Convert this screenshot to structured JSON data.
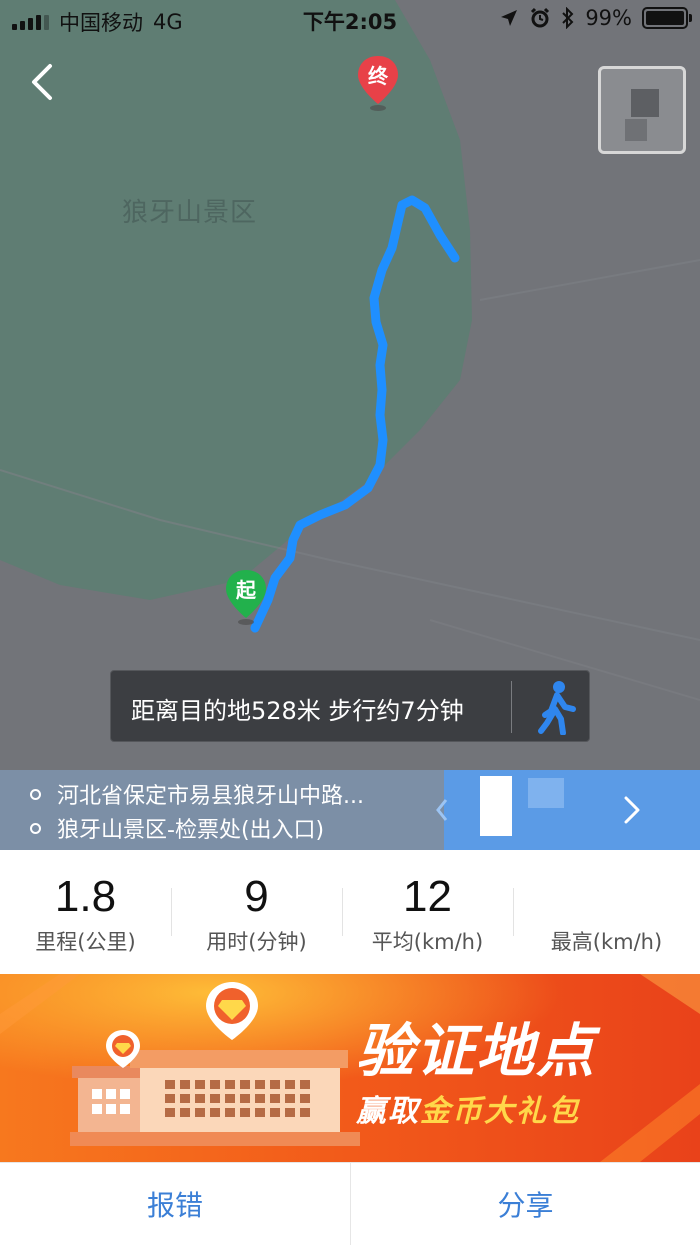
{
  "status_bar": {
    "carrier": "中国移动",
    "network": "4G",
    "time": "下午2:05",
    "battery": "99%"
  },
  "map": {
    "scenic_label": "狼牙山景区",
    "start_marker": "起",
    "end_marker": "终",
    "route_color": "#1f8fff",
    "region_color": "#5f7d73",
    "background_color": "#727479",
    "info_text": "距离目的地528米 步行约7分钟",
    "mode_icon": "walking-person-icon"
  },
  "addresses": {
    "start": "河北省保定市易县狼牙山中路...",
    "end": "狼牙山景区-检票处(出入口)"
  },
  "stats": [
    {
      "value": "1.8",
      "label": "里程(公里)"
    },
    {
      "value": "9",
      "label": "用时(分钟)"
    },
    {
      "value": "12",
      "label": "平均(km/h)"
    },
    {
      "value": "",
      "label": "最高(km/h)"
    }
  ],
  "banner": {
    "title": "验证地点",
    "sub_prefix": "赢取",
    "sub_highlight": "金币大礼包",
    "accent": "#ffd84a"
  },
  "actions": {
    "report": "报错",
    "share": "分享"
  }
}
